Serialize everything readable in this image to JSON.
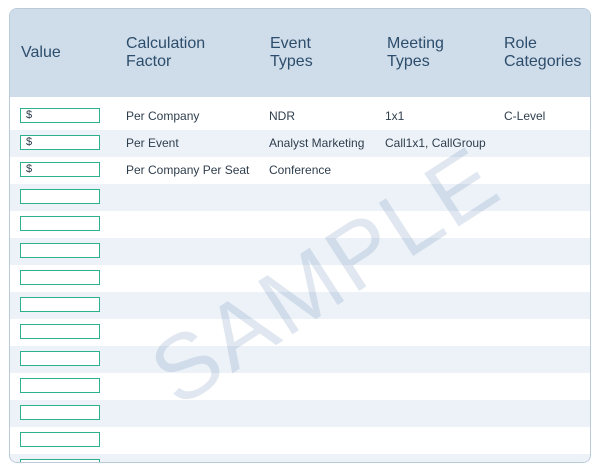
{
  "columns": {
    "value": [
      "Value"
    ],
    "calculation_factor": [
      "Calculation",
      "Factor"
    ],
    "event_types": [
      "Event",
      "Types"
    ],
    "meeting_types": [
      "Meeting",
      "Types"
    ],
    "role_categories": [
      "Role",
      "Categories"
    ]
  },
  "rows": [
    {
      "value": "$",
      "calculation_factor": "Per Company",
      "event_types": "NDR",
      "meeting_types": "1x1",
      "role_categories": "C-Level"
    },
    {
      "value": "$",
      "calculation_factor": "Per Event",
      "event_types": "Analyst Marketing",
      "meeting_types": "Call1x1, CallGroup",
      "role_categories": ""
    },
    {
      "value": "$",
      "calculation_factor": "Per Company Per Seat",
      "event_types": "Conference",
      "meeting_types": "",
      "role_categories": ""
    },
    {
      "value": "",
      "calculation_factor": "",
      "event_types": "",
      "meeting_types": "",
      "role_categories": ""
    },
    {
      "value": "",
      "calculation_factor": "",
      "event_types": "",
      "meeting_types": "",
      "role_categories": ""
    },
    {
      "value": "",
      "calculation_factor": "",
      "event_types": "",
      "meeting_types": "",
      "role_categories": ""
    },
    {
      "value": "",
      "calculation_factor": "",
      "event_types": "",
      "meeting_types": "",
      "role_categories": ""
    },
    {
      "value": "",
      "calculation_factor": "",
      "event_types": "",
      "meeting_types": "",
      "role_categories": ""
    },
    {
      "value": "",
      "calculation_factor": "",
      "event_types": "",
      "meeting_types": "",
      "role_categories": ""
    },
    {
      "value": "",
      "calculation_factor": "",
      "event_types": "",
      "meeting_types": "",
      "role_categories": ""
    },
    {
      "value": "",
      "calculation_factor": "",
      "event_types": "",
      "meeting_types": "",
      "role_categories": ""
    },
    {
      "value": "",
      "calculation_factor": "",
      "event_types": "",
      "meeting_types": "",
      "role_categories": ""
    },
    {
      "value": "",
      "calculation_factor": "",
      "event_types": "",
      "meeting_types": "",
      "role_categories": ""
    },
    {
      "value": "",
      "calculation_factor": "",
      "event_types": "",
      "meeting_types": "",
      "role_categories": ""
    }
  ],
  "watermark": "SAMPLE",
  "colors": {
    "header_bg": "#cfdcea",
    "header_text": "#2c4d6b",
    "alt_row": "#ecf2f8",
    "input_border": "#2db08e",
    "border": "#b9cadb"
  }
}
